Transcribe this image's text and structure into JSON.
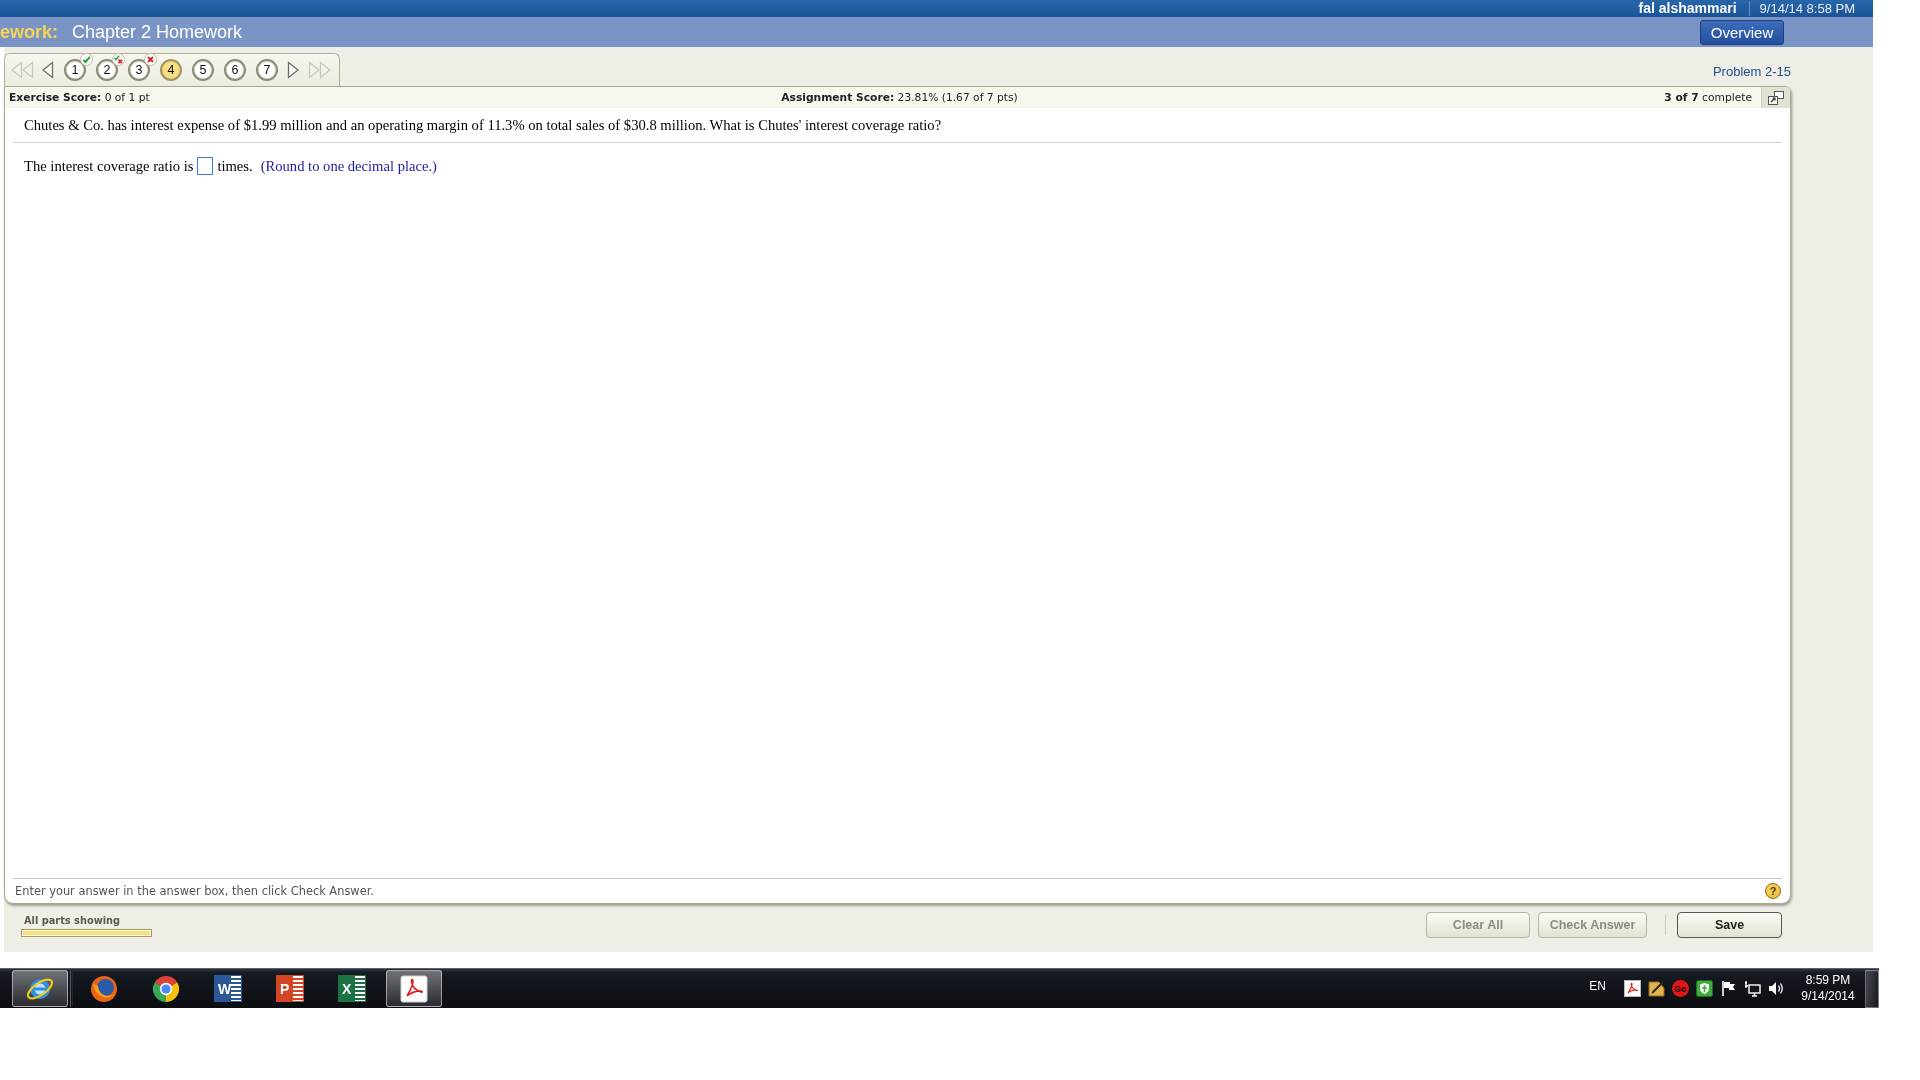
{
  "header": {
    "user_name": "fal alshammari",
    "date_time": "9/14/14 8:58 PM"
  },
  "title_bar": {
    "section": "ework:",
    "title": "Chapter 2 Homework",
    "overview_button": "Overview"
  },
  "question_nav": {
    "back": [
      {
        "kind": "first",
        "disabled": true
      },
      {
        "kind": "previous",
        "disabled": false
      }
    ],
    "questions": [
      {
        "number": "1",
        "kind": "correct",
        "selected": false
      },
      {
        "number": "2",
        "kind": "partial",
        "selected": false
      },
      {
        "number": "3",
        "kind": "incorrect",
        "selected": false
      },
      {
        "number": "4",
        "kind": "unanswered",
        "selected": true
      },
      {
        "number": "5",
        "kind": "unanswered",
        "selected": false
      },
      {
        "number": "6",
        "kind": "unanswered",
        "selected": false
      },
      {
        "number": "7",
        "kind": "unanswered",
        "selected": false
      }
    ],
    "forward": [
      {
        "kind": "next",
        "disabled": false
      },
      {
        "kind": "last",
        "disabled": true
      }
    ]
  },
  "problem_label": "Problem 2-15",
  "score_bar": {
    "exercise_label": "Exercise Score:",
    "exercise_value": "0 of 1 pt",
    "assignment_label": "Assignment Score:",
    "assignment_value": "23.81% (1.67 of 7 pts)",
    "completed": "3 of 7",
    "completed_label": "complete"
  },
  "question": {
    "text": "Chutes & Co. has interest expense of $1.99 million and an operating margin of 11.3% on total sales of $30.8 million. What is Chutes' interest coverage ratio?",
    "answer_before": "The interest coverage ratio is",
    "answer_after": "times.",
    "hint": "(Round to one decimal place.)"
  },
  "instructions": "Enter your answer in the answer box, then click Check Answer.",
  "help_button": "?",
  "parts": {
    "label": "All parts showing",
    "level": 1
  },
  "action_buttons": [
    {
      "label": "Clear All",
      "disabled": true
    },
    {
      "label": "Check Answer",
      "disabled": true
    }
  ],
  "save_button": {
    "label": "Save",
    "disabled": false
  },
  "taskbar": {
    "apps": [
      {
        "kind": "ie",
        "highlighted": true
      },
      {
        "kind": "firefox",
        "highlighted": false
      },
      {
        "kind": "chrome",
        "highlighted": false
      },
      {
        "kind": "word",
        "letter": "W",
        "highlighted": false
      },
      {
        "kind": "powerpoint",
        "letter": "P",
        "highlighted": false
      },
      {
        "kind": "excel",
        "letter": "X",
        "highlighted": false
      },
      {
        "kind": "acrobat",
        "highlighted": true
      }
    ],
    "language": "EN",
    "tray_icons": [
      {
        "kind": "acrobat"
      },
      {
        "kind": "pen"
      },
      {
        "kind": "go",
        "label": "Go"
      },
      {
        "kind": "shield"
      },
      {
        "kind": "flag"
      },
      {
        "kind": "network"
      },
      {
        "kind": "volume"
      }
    ],
    "time": "8:59 PM",
    "date": "9/14/2014"
  }
}
